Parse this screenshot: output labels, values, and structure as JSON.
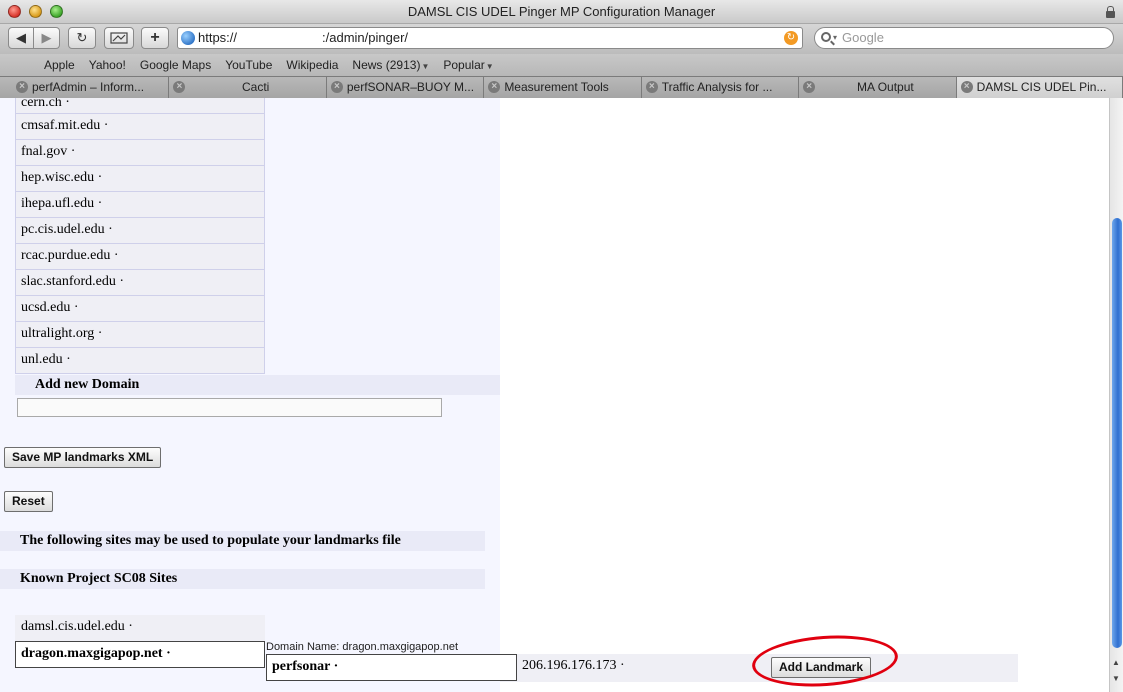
{
  "window": {
    "title": "DAMSL CIS UDEL Pinger MP Configuration Manager"
  },
  "toolbar": {
    "url_scheme": "https://",
    "url_path": ":/admin/pinger/",
    "search_placeholder": "Google",
    "back_glyph": "◀",
    "forward_glyph": "▶",
    "reload_glyph": "↻",
    "add_glyph": "+"
  },
  "bookmarks": [
    {
      "label": "Apple"
    },
    {
      "label": "Yahoo!"
    },
    {
      "label": "Google Maps"
    },
    {
      "label": "YouTube"
    },
    {
      "label": "Wikipedia"
    },
    {
      "label": "News (2913)",
      "dropdown": true
    },
    {
      "label": "Popular",
      "dropdown": true
    }
  ],
  "tabs": [
    {
      "label": "perfAdmin – Inform..."
    },
    {
      "label": "Cacti"
    },
    {
      "label": "perfSONAR–BUOY M..."
    },
    {
      "label": "Measurement Tools"
    },
    {
      "label": "Traffic Analysis for ..."
    },
    {
      "label": "MA Output"
    },
    {
      "label": "DAMSL CIS UDEL Pin...",
      "active": true
    }
  ],
  "domains": [
    "cern.ch ·",
    "cmsaf.mit.edu ·",
    "fnal.gov ·",
    "hep.wisc.edu ·",
    "ihepa.ufl.edu ·",
    "pc.cis.udel.edu ·",
    "rcac.purdue.edu ·",
    "slac.stanford.edu ·",
    "ucsd.edu ·",
    "ultralight.org ·",
    "unl.edu ·"
  ],
  "add_domain": {
    "header": "Add new Domain",
    "value": ""
  },
  "buttons": {
    "save": "Save MP landmarks XML",
    "reset": "Reset",
    "add_landmark": "Add Landmark"
  },
  "sites_intro": "The following sites may be used to populate your landmarks file",
  "known_sites": {
    "header": "Known Project SC08 Sites",
    "items": [
      "damsl.cis.udel.edu ·",
      "dragon.maxgigapop.net ·"
    ]
  },
  "landmark_row": {
    "domain_label": "Domain Name: dragon.maxgigapop.net",
    "host": "perfsonar ·",
    "ip": "206.196.176.173 ·"
  },
  "colors": {
    "annotation": "#e0000f",
    "scroll_thumb": "#2f6fd0",
    "panel_bg": "#f5f6ff"
  }
}
